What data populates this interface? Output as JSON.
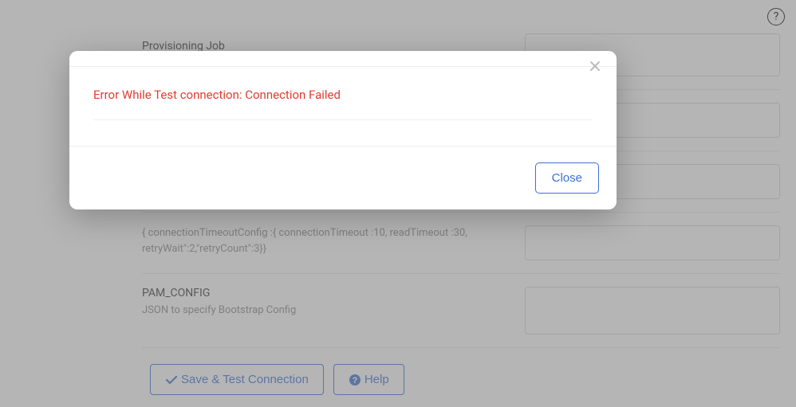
{
  "header": {
    "help_tooltip": "?"
  },
  "form": {
    "provisioning_label": "Provisioning Job",
    "config_title": "",
    "config_desc": "{ connectionTimeoutConfig :{ connectionTimeout :10, readTimeout :30, retryWait\":2,\"retryCount\":3}}",
    "pam_title": "PAM_CONFIG",
    "pam_desc": "JSON to specify Bootstrap Config"
  },
  "buttons": {
    "save_test": "Save & Test Connection",
    "help": "Help",
    "close": "Close"
  },
  "modal": {
    "error_message": "Error While Test connection: Connection Failed"
  }
}
